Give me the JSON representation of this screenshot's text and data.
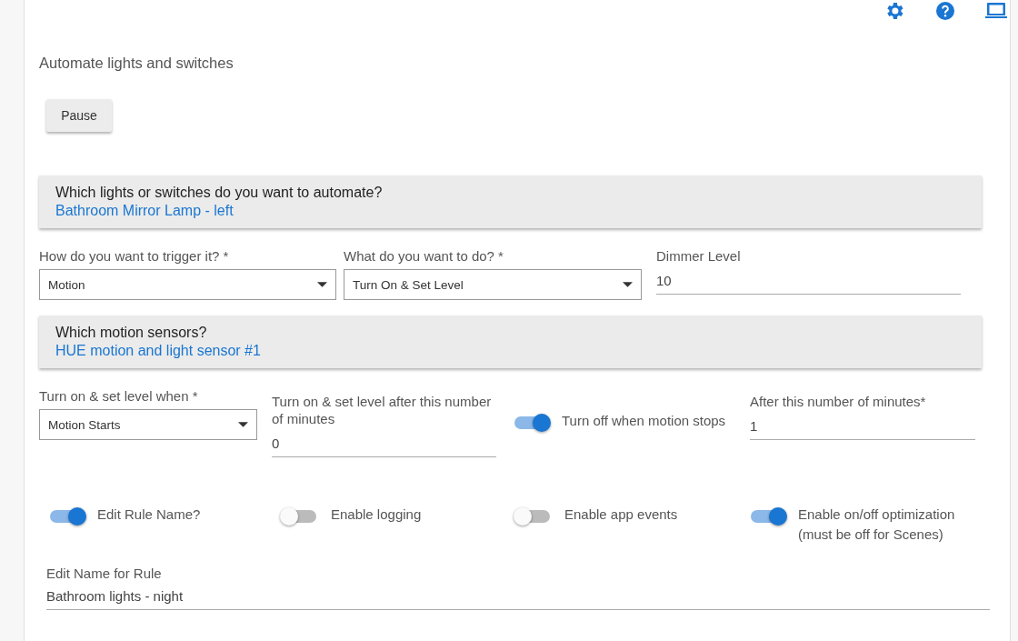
{
  "title": "Automate lights and switches",
  "pause_button": "Pause",
  "device_section": {
    "question": "Which lights or switches do you want to automate?",
    "value": "Bathroom Mirror Lamp - left"
  },
  "trigger_row": [
    {
      "kind": "select",
      "label": "How do you want to trigger it? *",
      "value": "Motion"
    },
    {
      "kind": "select",
      "label": "What do you want to do? *",
      "value": "Turn On & Set Level"
    },
    {
      "kind": "text",
      "label": "Dimmer Level",
      "value": "10"
    }
  ],
  "sensor_section": {
    "question": "Which motion sensors?",
    "value": "HUE motion and light sensor #1"
  },
  "motion_row": [
    {
      "kind": "select",
      "label": "Turn on & set level when *",
      "value": "Motion Starts"
    },
    {
      "kind": "text",
      "label": "Turn on & set level after this number of minutes",
      "value": "0"
    },
    {
      "kind": "toggle",
      "label": "Turn off when motion stops",
      "on": true
    },
    {
      "kind": "text",
      "label": "After this number of minutes*",
      "value": "1"
    }
  ],
  "options": [
    {
      "label": "Edit Rule Name?",
      "on": true
    },
    {
      "label": "Enable logging",
      "on": false
    },
    {
      "label": "Enable app events",
      "on": false
    },
    {
      "label": "Enable on/off optimization (must be off for Scenes)",
      "on": true
    }
  ],
  "rule_name": {
    "label": "Edit Name for Rule",
    "value": "Bathroom lights - night"
  }
}
